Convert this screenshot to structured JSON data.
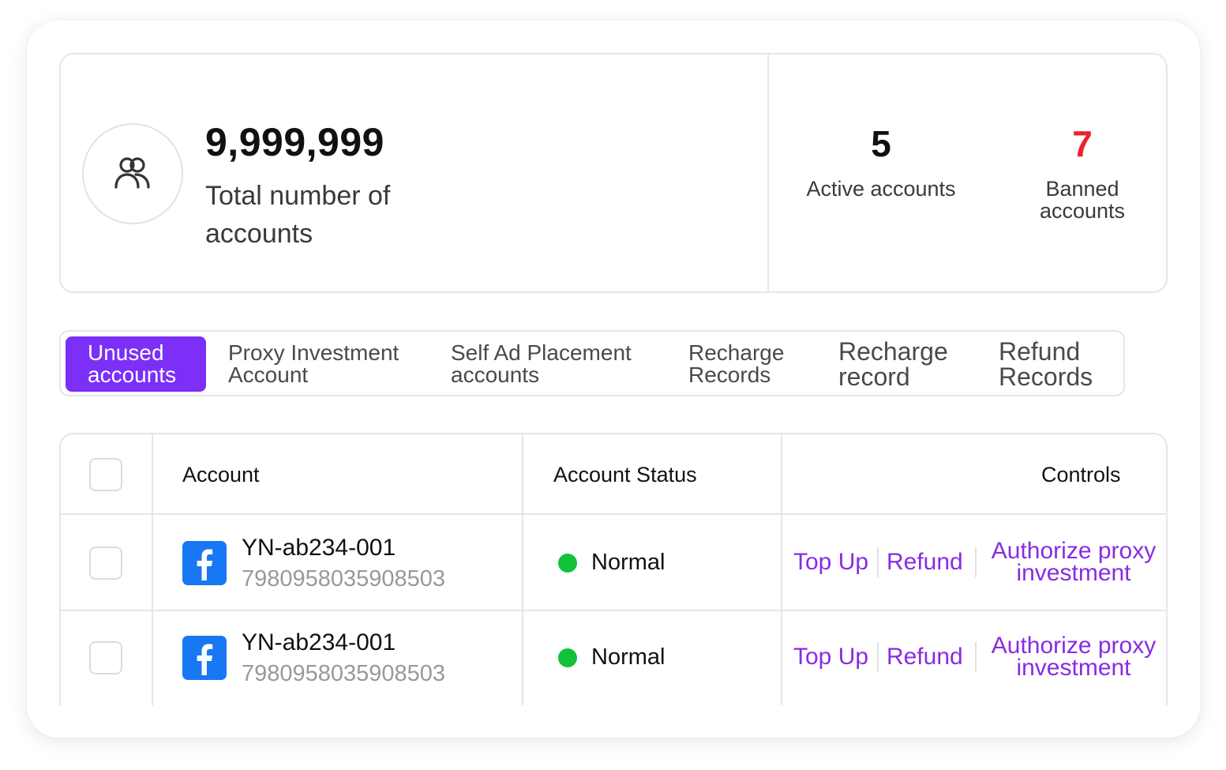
{
  "summary": {
    "total_value": "9,999,999",
    "total_label": "Total number of accounts",
    "active": {
      "value": "5",
      "label": "Active accounts"
    },
    "banned": {
      "value": "7",
      "label": "Banned accounts",
      "color": "#e8262a"
    },
    "icon": "users-icon"
  },
  "tabs": [
    {
      "label": "Unused accounts",
      "active": true
    },
    {
      "label": "Proxy Investment Account",
      "active": false
    },
    {
      "label": "Self Ad Placement accounts",
      "active": false
    },
    {
      "label": "Recharge Records",
      "active": false
    },
    {
      "label": "Recharge record",
      "active": false
    },
    {
      "label": "Refund Records",
      "active": false
    }
  ],
  "table": {
    "headers": {
      "account": "Account",
      "status": "Account Status",
      "controls": "Controls"
    },
    "rows": [
      {
        "platform_icon": "facebook-icon",
        "name": "YN-ab234-001",
        "id": "7980958035908503",
        "status": "Normal",
        "controls": {
          "top_up": "Top Up",
          "refund": "Refund",
          "authorize": "Authorize proxy investment"
        }
      },
      {
        "platform_icon": "facebook-icon",
        "name": "YN-ab234-001",
        "id": "7980958035908503",
        "status": "Normal",
        "controls": {
          "top_up": "Top Up",
          "refund": "Refund",
          "authorize": "Authorize proxy investment"
        }
      }
    ]
  },
  "colors": {
    "accent": "#7b2ff7",
    "link": "#8a2be2",
    "status_normal": "#12c23a",
    "facebook": "#1877f2"
  }
}
